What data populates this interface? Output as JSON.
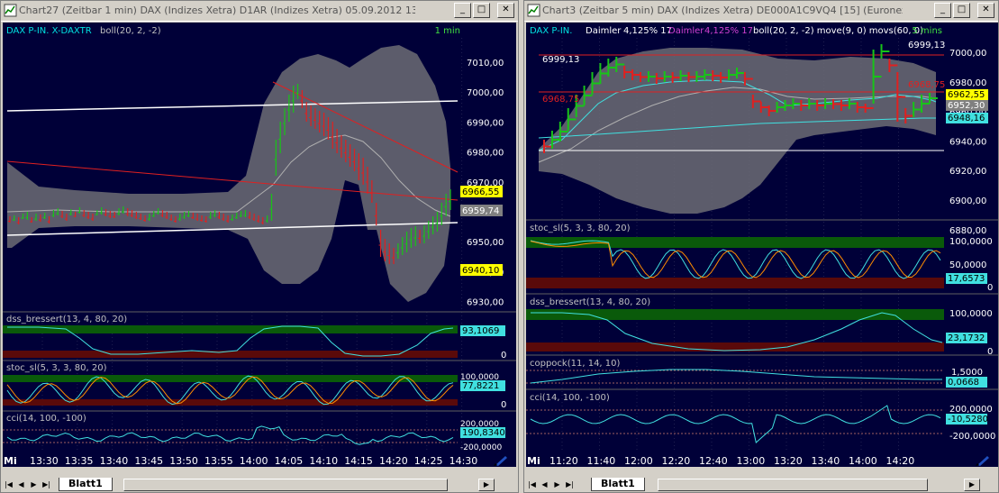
{
  "left_window": {
    "title": "Chart27 (Zeitbar 1 min)  DAX (Indizes Xetra) D1AR (Indizes Xetra) 05.09.2012 13:23 - 0...",
    "header_instrument": "DAX P-IN. X-DAXTR",
    "header_indicator": "boll(20, 2, -2)",
    "interval": "1 min",
    "price_axis": [
      "7010,00",
      "7000,00",
      "6990,00",
      "6980,00",
      "6970,00",
      "6960,00",
      "6950,00",
      "6940,00",
      "6930,00"
    ],
    "labels": {
      "last": "6966,55",
      "boll_mid": "6959,74",
      "low": "6940,10"
    },
    "subpanels": [
      {
        "title": "dss_bressert(13, 4, 80, 20)",
        "value": "93,1069",
        "axis": [
          "0"
        ]
      },
      {
        "title": "stoc_sl(5, 3, 3, 80, 20)",
        "value": "77,8221",
        "axis": [
          "100,0000",
          "0"
        ]
      },
      {
        "title": "cci(14, 100, -100)",
        "value": "190,8340",
        "axis": [
          "200,0000",
          "-200,0000"
        ]
      }
    ],
    "time_prefix": "Mi",
    "time_axis": [
      "13:30",
      "13:35",
      "13:40",
      "13:45",
      "13:50",
      "13:55",
      "14:00",
      "14:05",
      "14:10",
      "14:15",
      "14:20",
      "14:25",
      "14:30"
    ],
    "sheet_tab": "Blatt1"
  },
  "right_window": {
    "title": "Chart3 (Zeitbar 5 min)  DAX (Indizes Xetra) DE000A1C9VQ4 [15] (Euronext)",
    "header_instrument": "DAX P-IN.",
    "header_stock": "Daimler",
    "header_pct": "4,125% 17",
    "header_stock2": "Daimler",
    "header_pct2": "4,125% 17",
    "header_indicators": "boll(20, 2, -2) move(9, 0) movs(60, 0)",
    "interval": "5 mins",
    "price_axis": [
      "7000,00",
      "6990,00",
      "6980,00",
      "6970,00",
      "6960,00",
      "6950,00",
      "6940,00",
      "6930,00",
      "6920,00",
      "6910,00",
      "6900,00",
      "6890,00",
      "6880,00"
    ],
    "annotations": {
      "high_top": "6999,13",
      "high_left": "6999,13",
      "mid_left": "6968,75",
      "mid_right": "6968,75"
    },
    "labels": {
      "last": "6962,55",
      "boll_mid": "6952,30",
      "ma": "6948,16"
    },
    "subpanels": [
      {
        "title": "stoc_sl(5, 3, 3, 80, 20)",
        "value": "17,6573",
        "axis": [
          "100,0000",
          "50,0000",
          "0"
        ]
      },
      {
        "title": "dss_bressert(13, 4, 80, 20)",
        "value": "23,1732",
        "axis": [
          "100,0000",
          "0"
        ]
      },
      {
        "title": "coppock(11, 14, 10)",
        "value": "0,0668",
        "axis": [
          "1,5000"
        ]
      },
      {
        "title": "cci(14, 100, -100)",
        "value": "-10,5280",
        "axis": [
          "200,0000",
          "-200,0000"
        ]
      }
    ],
    "time_prefix": "Mi",
    "time_axis": [
      "11:20",
      "11:40",
      "12:00",
      "12:20",
      "12:40",
      "13:00",
      "13:20",
      "13:40",
      "14:00",
      "14:20"
    ],
    "sheet_tab": "Blatt1"
  },
  "colors": {
    "chart_bg": "#000038",
    "band": "#6c6c74",
    "green": "#18c418",
    "red": "#e02020",
    "yellow": "#ffff00",
    "cyan": "#40e0e0",
    "orange": "#ff8c00",
    "zone_green": "#0a5a0a",
    "zone_red": "#5a0a0a"
  },
  "icons": [
    "chart-window-icon",
    "minimize-icon",
    "maximize-icon",
    "close-icon",
    "first-sheet-icon",
    "prev-sheet-icon",
    "next-sheet-icon",
    "last-sheet-icon",
    "pen-icon",
    "scroll-right-icon"
  ]
}
